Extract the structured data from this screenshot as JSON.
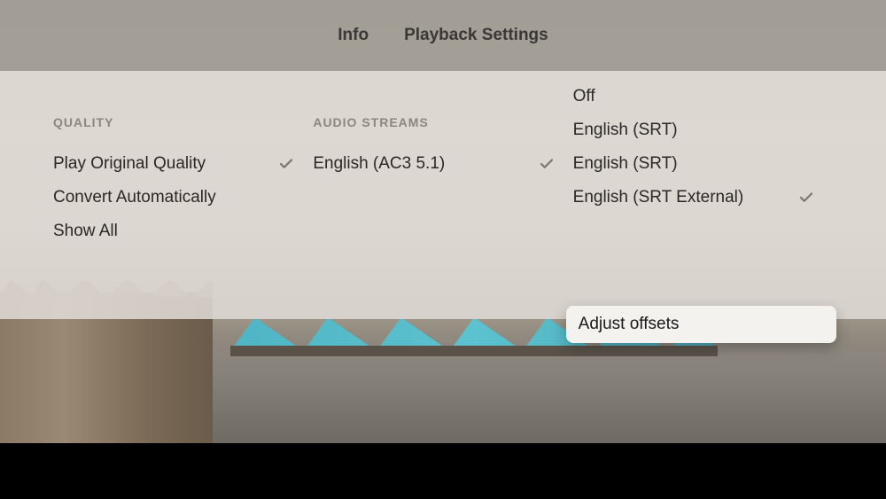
{
  "tabs": {
    "info": "Info",
    "playback_settings": "Playback Settings"
  },
  "columns": {
    "quality": {
      "header": "QUALITY",
      "items": [
        {
          "label": "Play Original Quality",
          "checked": true
        },
        {
          "label": "Convert Automatically",
          "checked": false
        },
        {
          "label": "Show All",
          "checked": false
        }
      ]
    },
    "audio": {
      "header": "AUDIO STREAMS",
      "items": [
        {
          "label": "English (AC3 5.1)",
          "checked": true
        }
      ]
    },
    "subtitles": {
      "items": [
        {
          "label": "Off",
          "checked": false
        },
        {
          "label": "English (SRT)",
          "checked": false
        },
        {
          "label": "English (SRT)",
          "checked": false
        },
        {
          "label": "English (SRT External)",
          "checked": true
        }
      ],
      "highlighted": "Adjust offsets"
    }
  }
}
